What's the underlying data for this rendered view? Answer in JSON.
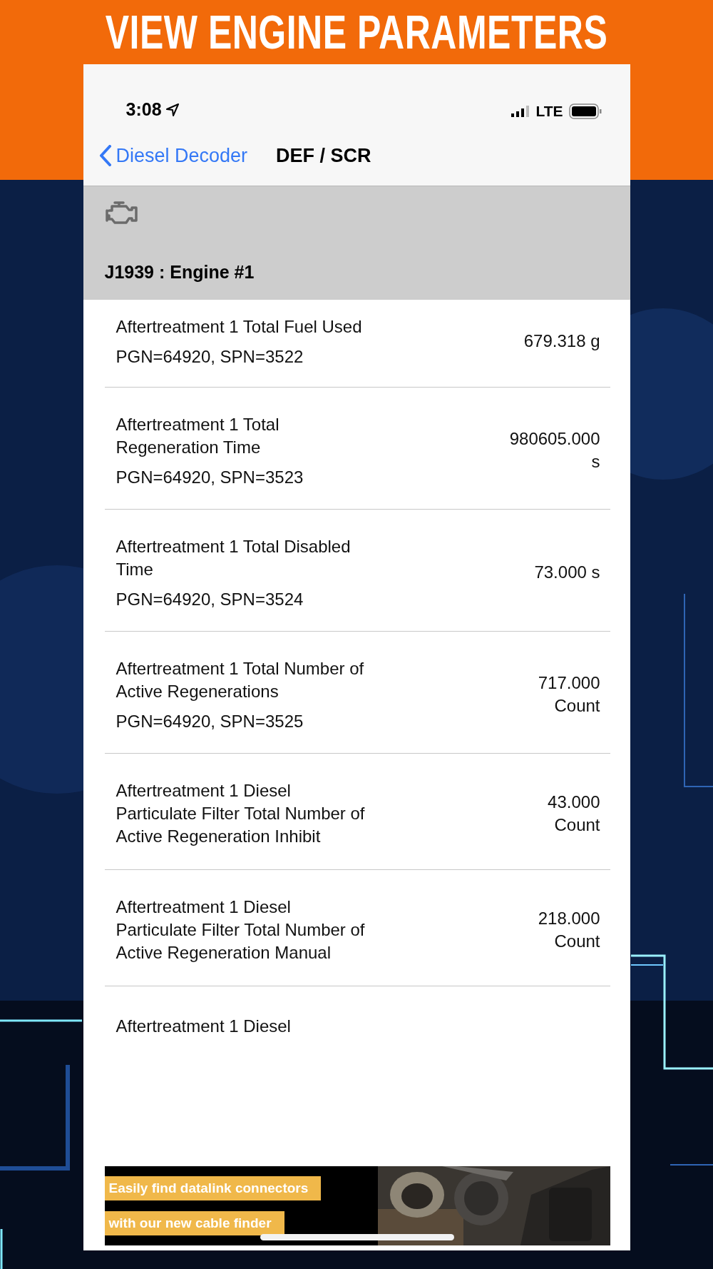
{
  "header": {
    "title": "VIEW ENGINE PARAMETERS"
  },
  "status_bar": {
    "time": "3:08",
    "network": "LTE"
  },
  "nav": {
    "back": "Diesel Decoder",
    "title": "DEF / SCR"
  },
  "section": {
    "title": "J1939 : Engine #1"
  },
  "parameters": [
    {
      "name": "Aftertreatment 1 Total Fuel Used",
      "pgn": "PGN=64920, SPN=3522",
      "value": "679.318 g"
    },
    {
      "name": "Aftertreatment 1 Total Regeneration Time",
      "pgn": "PGN=64920, SPN=3523",
      "value": "980605.000 s"
    },
    {
      "name": "Aftertreatment 1 Total Disabled Time",
      "pgn": "PGN=64920, SPN=3524",
      "value": "73.000 s"
    },
    {
      "name": "Aftertreatment 1 Total Number of Active Regenerations",
      "pgn": "PGN=64920, SPN=3525",
      "value": "717.000 Count"
    },
    {
      "name": "Aftertreatment 1 Diesel Particulate Filter Total Number of Active Regeneration Inhibit",
      "value": "43.000 Count"
    },
    {
      "name": "Aftertreatment 1 Diesel Particulate Filter Total Number of Active Regeneration Manual",
      "value": "218.000 Count"
    },
    {
      "name": "Aftertreatment 1 Diesel"
    }
  ],
  "ad": {
    "lines": [
      "Easily find datalink connectors",
      "with our new cable finder"
    ]
  }
}
